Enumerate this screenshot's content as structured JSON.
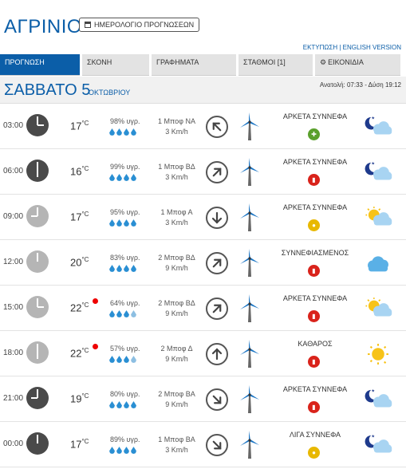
{
  "header": {
    "city": "ΑΓΡΙΝΙΟ",
    "calendar_button": "ΗΜΕΡΟΛΟΓΙΟ ΠΡΟΓΝΩΣΕΩΝ",
    "links": "ΕΚΤΥΠΩΣΗ | ENGLISH VERSION"
  },
  "tabs": [
    {
      "label": "ΠΡΟΓΝΩΣΗ"
    },
    {
      "label": "ΣΚΟΝΗ"
    },
    {
      "label": "ΓΡΑΦΗΜΑΤΑ"
    },
    {
      "label": "ΣΤΑΘΜΟΙ [1]"
    },
    {
      "label": "ΕΙΚΟΝΙΔΙΑ"
    }
  ],
  "day": {
    "name": "ΣΑΒΒΑΤΟ 5",
    "month": "ΟΚΤΩΒΡΙΟΥ",
    "sun": "Ανατολή: 07:33 - Δύση 19:12"
  },
  "rows": [
    {
      "time": "03:00",
      "temp": "17",
      "humidity": "98% υγρ.",
      "wind_bft": "1 Μποφ ΝΑ",
      "wind_kmh": "3 Km/h",
      "desc": "ΑΡΚΕΤΑ ΣΥΝΝΕΦΑ"
    },
    {
      "time": "06:00",
      "temp": "16",
      "humidity": "99% υγρ.",
      "wind_bft": "1 Μποφ ΒΔ",
      "wind_kmh": "3 Km/h",
      "desc": "ΑΡΚΕΤΑ ΣΥΝΝΕΦΑ"
    },
    {
      "time": "09:00",
      "temp": "17",
      "humidity": "95% υγρ.",
      "wind_bft": "1 Μποφ Α",
      "wind_kmh": "3 Km/h",
      "desc": "ΑΡΚΕΤΑ ΣΥΝΝΕΦΑ"
    },
    {
      "time": "12:00",
      "temp": "20",
      "humidity": "83% υγρ.",
      "wind_bft": "2 Μποφ ΒΔ",
      "wind_kmh": "9 Km/h",
      "desc": "ΣΥΝΝΕΦΙΑΣΜΕΝΟΣ"
    },
    {
      "time": "15:00",
      "temp": "22",
      "humidity": "64% υγρ.",
      "wind_bft": "2 Μποφ ΒΔ",
      "wind_kmh": "9 Km/h",
      "desc": "ΑΡΚΕΤΑ ΣΥΝΝΕΦΑ"
    },
    {
      "time": "18:00",
      "temp": "22",
      "humidity": "57% υγρ.",
      "wind_bft": "2 Μποφ Δ",
      "wind_kmh": "9 Km/h",
      "desc": "ΚΑΘΑΡΟΣ"
    },
    {
      "time": "21:00",
      "temp": "19",
      "humidity": "80% υγρ.",
      "wind_bft": "2 Μποφ ΒΑ",
      "wind_kmh": "9 Km/h",
      "desc": "ΑΡΚΕΤΑ ΣΥΝΝΕΦΑ"
    },
    {
      "time": "00:00",
      "temp": "17",
      "humidity": "89% υγρ.",
      "wind_bft": "1 Μποφ ΒΑ",
      "wind_kmh": "3 Km/h",
      "desc": "ΛΙΓΑ ΣΥΝΝΕΦΑ"
    }
  ],
  "units": {
    "celsius": "°C"
  },
  "colors": {
    "brand": "#0b5ea8",
    "uv_green": "#5aa02c",
    "uv_yellow": "#e8b800",
    "uv_red": "#d9231b",
    "drop": "#2a8fd3"
  }
}
